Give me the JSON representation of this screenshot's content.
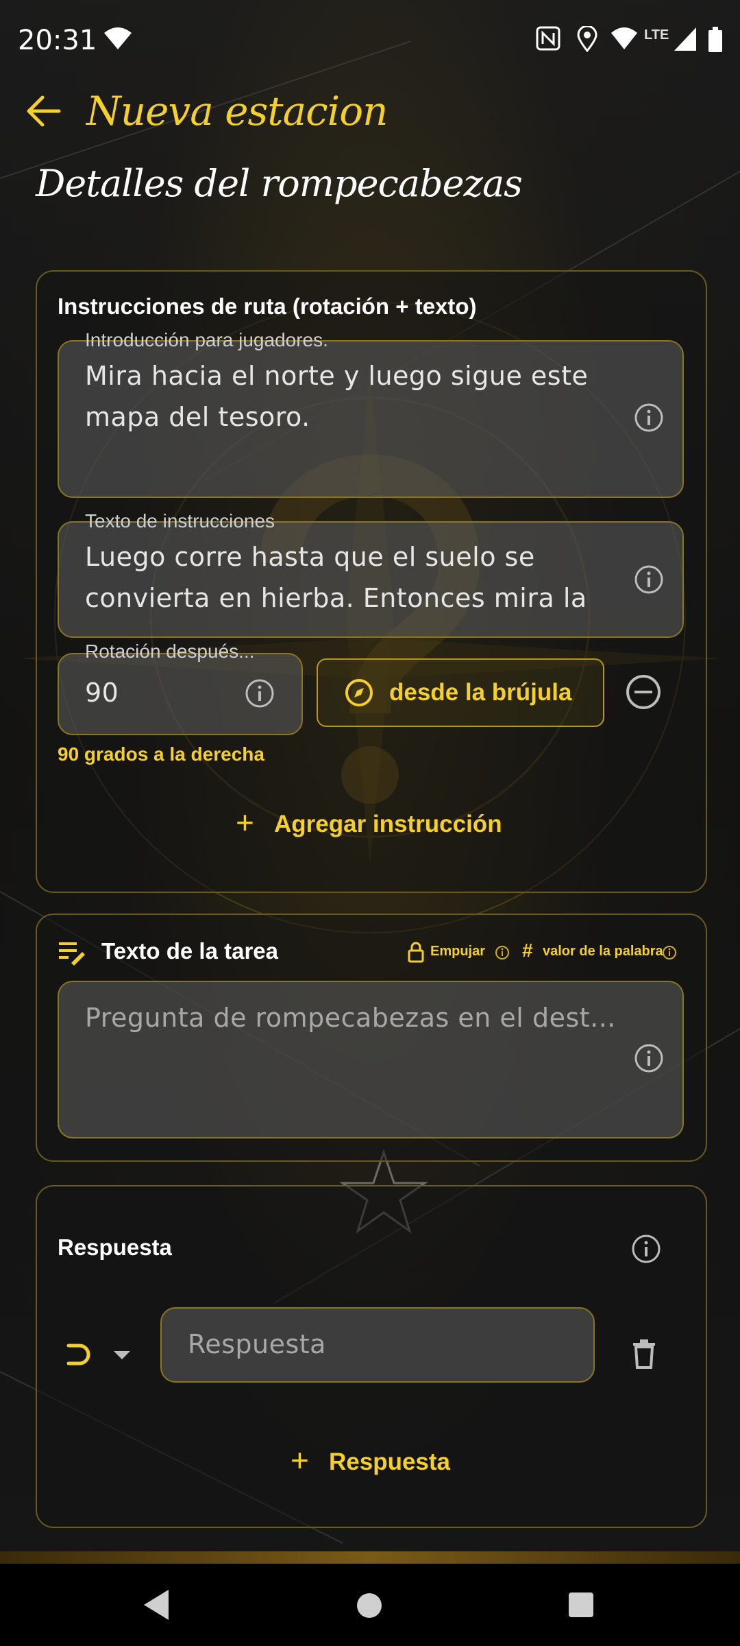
{
  "status_bar": {
    "time": "20:31",
    "network_label": "LTE"
  },
  "app_bar": {
    "title": "Nueva estacion"
  },
  "page": {
    "section_title": "Detalles del rompecabezas"
  },
  "route_card": {
    "label": "Instrucciones de ruta (rotación + texto)",
    "intro_field": {
      "label": "Introducción para jugadores.",
      "value_line1": "Mira hacia el norte y luego sigue este",
      "value_line2": "mapa del tesoro."
    },
    "instructions_field": {
      "label": "Texto de instrucciones",
      "value_line1": "Luego corre hasta que el suelo se",
      "value_line2": "convierta en hierba. Entonces mira la"
    },
    "rotation_field": {
      "label": "Rotación después...",
      "value": "90"
    },
    "compass_button": "desde la brújula",
    "rotation_hint": "90 grados a la derecha",
    "add_instruction": "Agregar instrucción"
  },
  "task_card": {
    "label": "Texto de la tarea",
    "push_label": "Empujar",
    "word_value_label": "valor de la palabra",
    "question_placeholder": "Pregunta de rompecabezas en el dest..."
  },
  "answer_card": {
    "label": "Respuesta",
    "answer_placeholder": "Respuesta",
    "add_answer": "Respuesta"
  },
  "colors": {
    "accent": "#f5cf2b",
    "border": "#6a5a1d",
    "background": "#151515"
  }
}
